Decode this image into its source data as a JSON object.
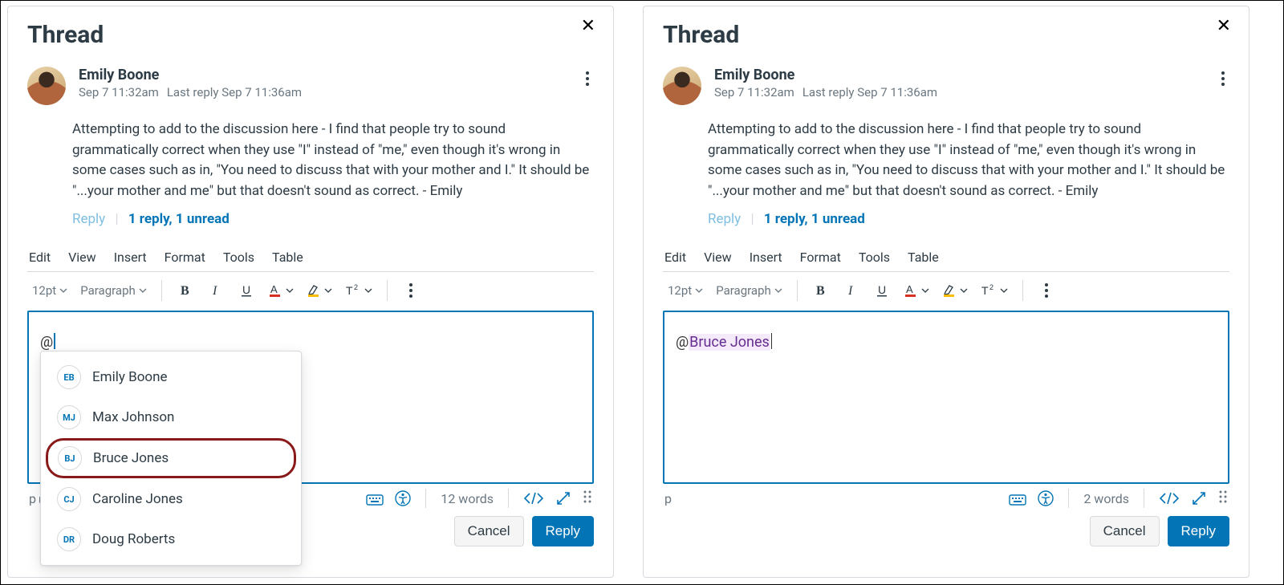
{
  "left": {
    "title": "Thread",
    "post": {
      "author": "Emily Boone",
      "timestamp": "Sep 7 11:32am",
      "last_reply_label": "Last reply Sep 7 11:36am",
      "body": "Attempting to add to the discussion here - I find that people try to sound grammatically correct when they use \"I\" instead of \"me,\" even though it's wrong in some cases such as in, \"You need to discuss that with your mother and I.\" It should be \"...your mother and me\" but that doesn't sound as correct. - Emily",
      "reply_label": "Reply",
      "replies_summary": "1 reply, 1 unread"
    },
    "editor": {
      "menu": {
        "edit": "Edit",
        "view": "View",
        "insert": "Insert",
        "format": "Format",
        "tools": "Tools",
        "table": "Table"
      },
      "font_size_label": "12pt",
      "block_label": "Paragraph",
      "content_raw": "@",
      "mention_dropdown": [
        {
          "initials": "EB",
          "name": "Emily Boone",
          "highlighted": false
        },
        {
          "initials": "MJ",
          "name": "Max Johnson",
          "highlighted": false
        },
        {
          "initials": "BJ",
          "name": "Bruce Jones",
          "highlighted": true
        },
        {
          "initials": "CJ",
          "name": "Caroline Jones",
          "highlighted": false
        },
        {
          "initials": "DR",
          "name": "Doug Roberts",
          "highlighted": false
        }
      ],
      "path_label": "p ▸ span",
      "word_count": "12 words",
      "cancel_label": "Cancel",
      "reply_label": "Reply"
    }
  },
  "right": {
    "title": "Thread",
    "post": {
      "author": "Emily Boone",
      "timestamp": "Sep 7 11:32am",
      "last_reply_label": "Last reply Sep 7 11:36am",
      "body": "Attempting to add to the discussion here - I find that people try to sound grammatically correct when they use \"I\" instead of \"me,\" even though it's wrong in some cases such as in, \"You need to discuss that with your mother and I.\" It should be \"...your mother and me\" but that doesn't sound as correct. - Emily",
      "reply_label": "Reply",
      "replies_summary": "1 reply, 1 unread"
    },
    "editor": {
      "menu": {
        "edit": "Edit",
        "view": "View",
        "insert": "Insert",
        "format": "Format",
        "tools": "Tools",
        "table": "Table"
      },
      "font_size_label": "12pt",
      "block_label": "Paragraph",
      "content_prefix": "@",
      "mention_text": "Bruce Jones",
      "path_label": "p",
      "word_count": "2 words",
      "cancel_label": "Cancel",
      "reply_label": "Reply"
    }
  }
}
